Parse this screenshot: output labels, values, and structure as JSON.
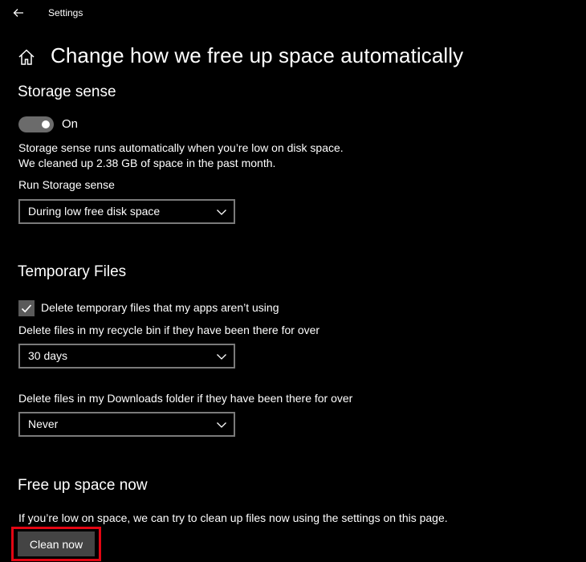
{
  "window": {
    "title": "Settings"
  },
  "page": {
    "title": "Change how we free up space automatically"
  },
  "storage_sense": {
    "title": "Storage sense",
    "toggle_state": "On",
    "toggle_on": true,
    "description_line1": "Storage sense runs automatically when you’re low on disk space.",
    "description_line2": "We cleaned up 2.38 GB of space in the past month.",
    "run_label": "Run Storage sense",
    "run_value": "During low free disk space"
  },
  "temporary_files": {
    "title": "Temporary Files",
    "delete_temp_label": "Delete temporary files that my apps aren’t using",
    "delete_temp_checked": true,
    "recycle_bin_label": "Delete files in my recycle bin if they have been there for over",
    "recycle_bin_value": "30 days",
    "downloads_label": "Delete files in my Downloads folder if they have been there for over",
    "downloads_value": "Never"
  },
  "free_up_now": {
    "title": "Free up space now",
    "description": "If you’re low on space, we can try to clean up files now using the settings on this page.",
    "button_label": "Clean now"
  },
  "icons": {
    "back": "back-arrow-icon",
    "home": "home-icon",
    "chevron": "chevron-down-icon",
    "check": "checkmark-icon"
  },
  "colors": {
    "background": "#000000",
    "text": "#ffffff",
    "toggle_track": "#6b6b6b",
    "dropdown_border": "#7a7a7a",
    "button_bg": "#444444",
    "highlight": "#e30613"
  }
}
